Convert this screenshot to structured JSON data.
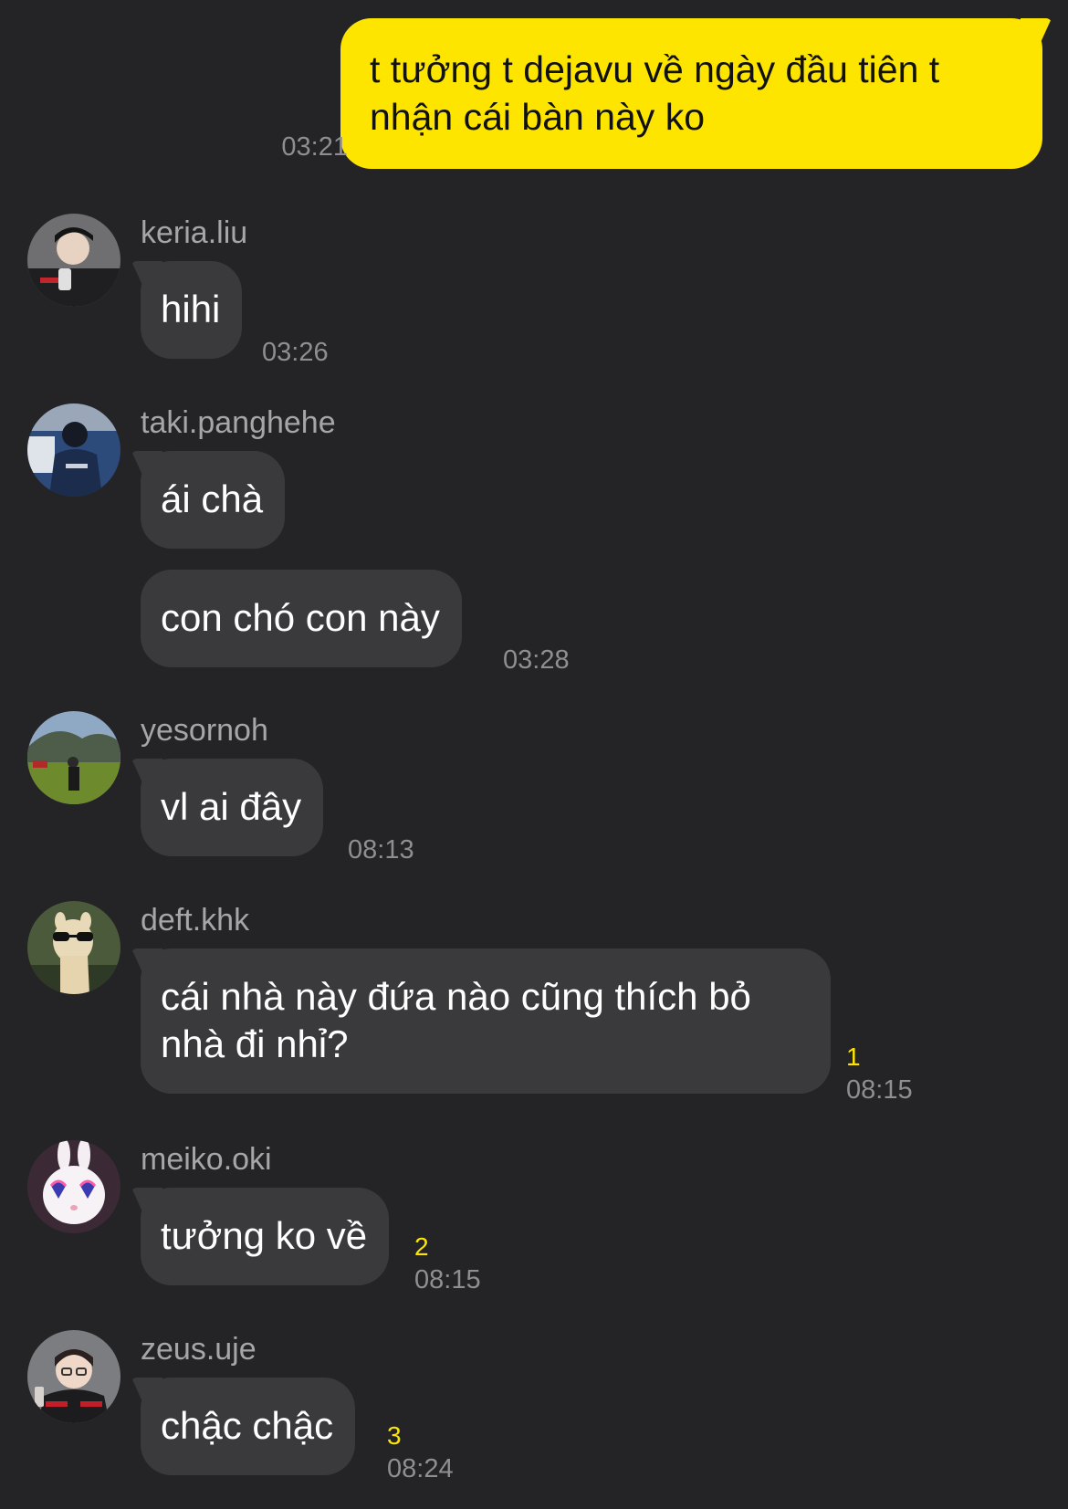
{
  "colors": {
    "background": "#242426",
    "outgoing_bubble": "#FEE500",
    "incoming_bubble": "#3a3a3c",
    "unread_count": "#FEE500",
    "timestamp": "#8e8e93",
    "sender_name": "#a6a6aa"
  },
  "outgoing": {
    "text": "t tưởng t dejavu về ngày đầu tiên t nhận cái bàn này ko",
    "time": "03:21"
  },
  "messages": [
    {
      "sender": "keria.liu",
      "avatar_icon": "profile-photo-icon",
      "bubbles": [
        "hihi"
      ],
      "time": "03:26",
      "unread": ""
    },
    {
      "sender": "taki.panghehe",
      "avatar_icon": "profile-photo-icon",
      "bubbles": [
        "ái chà",
        "con chó con này"
      ],
      "time": "03:28",
      "unread": ""
    },
    {
      "sender": "yesornoh",
      "avatar_icon": "profile-photo-icon",
      "bubbles": [
        "vl ai đây"
      ],
      "time": "08:13",
      "unread": ""
    },
    {
      "sender": "deft.khk",
      "avatar_icon": "alpaca-sunglasses-icon",
      "bubbles": [
        "cái nhà này đứa nào cũng thích bỏ nhà đi nhỉ?"
      ],
      "time": "08:15",
      "unread": "1"
    },
    {
      "sender": "meiko.oki",
      "avatar_icon": "rabbit-heart-glasses-icon",
      "bubbles": [
        "tưởng ko về"
      ],
      "time": "08:15",
      "unread": "2"
    },
    {
      "sender": "zeus.uje",
      "avatar_icon": "profile-photo-icon",
      "bubbles": [
        "chậc chậc"
      ],
      "time": "08:24",
      "unread": "3"
    }
  ]
}
